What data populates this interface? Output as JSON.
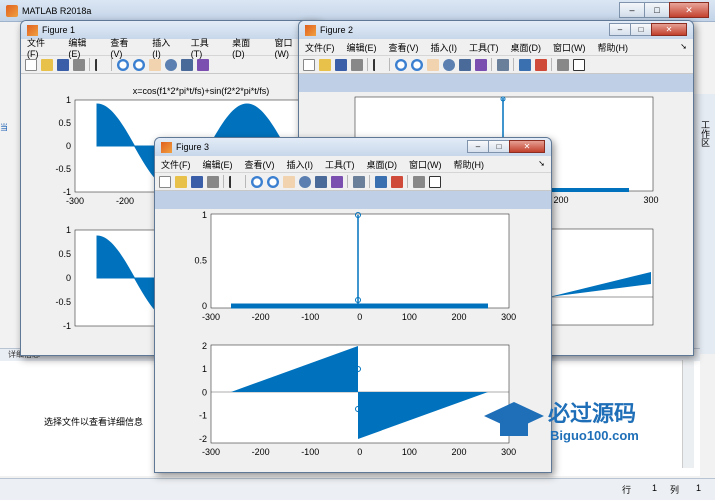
{
  "app": {
    "title": "MATLAB R2018a"
  },
  "window_controls": {
    "minimize": "–",
    "maximize": "□",
    "close": "✕"
  },
  "side": {
    "right_label": "工作区",
    "left_label": "当"
  },
  "details": {
    "header": "详细信息",
    "message": "选择文件以查看详细信息"
  },
  "status": {
    "row_label": "行",
    "row_value": "1",
    "col_label": "列",
    "col_value": "1"
  },
  "menu": [
    "文件(F)",
    "编辑(E)",
    "查看(V)",
    "插入(I)",
    "工具(T)",
    "桌面(D)",
    "窗口(W)",
    "帮助(H)"
  ],
  "figure1": {
    "title": "Figure 1",
    "plot_title": "x=cos(f1*2*pi*t/fs)+sin(f2*2*pi*t/fs)",
    "yticks_top": [
      "1",
      "0.5",
      "0",
      "-0.5",
      "-1"
    ],
    "xticks": [
      "-300",
      "-200"
    ],
    "yticks_bottom": [
      "1",
      "0.5",
      "0",
      "-0.5",
      "-1"
    ]
  },
  "figure2": {
    "title": "Figure 2",
    "xticks": [
      "200",
      "300"
    ]
  },
  "figure3": {
    "title": "Figure 3",
    "top": {
      "xticks": [
        "-300",
        "-200",
        "-100",
        "0",
        "100",
        "200",
        "300"
      ],
      "yticks": [
        "1",
        "0.5",
        "0"
      ]
    },
    "bottom": {
      "xticks": [
        "-300",
        "-200",
        "-100",
        "0",
        "100",
        "200",
        "300"
      ],
      "yticks": [
        "2",
        "1",
        "0",
        "-1",
        "-2"
      ]
    }
  },
  "watermark": {
    "brand": "必过源码",
    "url": "Biguo100.com"
  },
  "colors": {
    "plot_blue": "#0072bd",
    "window_frame": "#bfd0e6",
    "close_red": "#c4422f"
  },
  "chart_data": [
    {
      "type": "line",
      "panel": "figure1-top",
      "title": "x=cos(f1*2*pi*t/fs)+sin(f2*2*pi*t/fs)",
      "x": [
        -256,
        -200,
        -150,
        -100,
        -50,
        0
      ],
      "ylim": [
        -1,
        1
      ],
      "note_visible": "stem plot of a sinusoid, partially occluded"
    },
    {
      "type": "line",
      "panel": "figure3-top",
      "series": [
        {
          "values_x": [
            -256,
            0,
            256
          ],
          "values_y": [
            0,
            1,
            0
          ]
        }
      ],
      "xlim": [
        -300,
        300
      ],
      "ylim": [
        0,
        1
      ]
    },
    {
      "type": "line",
      "panel": "figure3-bottom",
      "series": [
        {
          "values_x": [
            -256,
            0,
            0,
            256
          ],
          "values_y": [
            0,
            2,
            -2,
            0
          ]
        }
      ],
      "xlim": [
        -300,
        300
      ],
      "ylim": [
        -2,
        2
      ]
    }
  ]
}
